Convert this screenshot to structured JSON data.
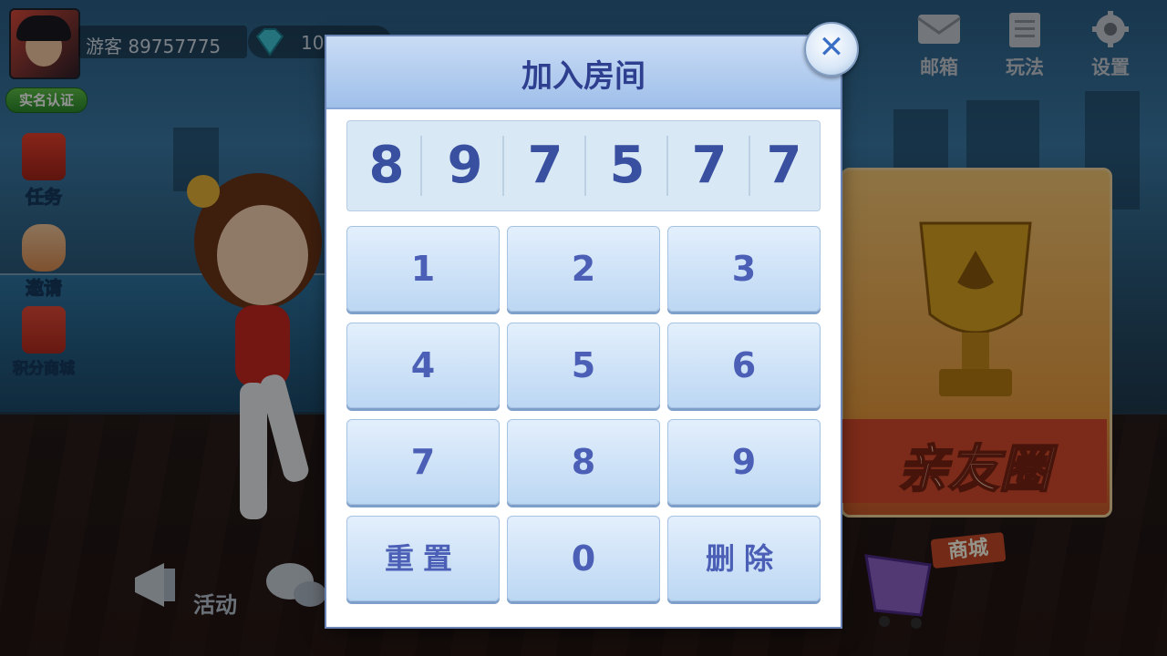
{
  "player": {
    "name": "游客 89757775",
    "gems_visible": "10",
    "verify_label": "实名认证"
  },
  "left_menu": [
    {
      "id": "tasks",
      "label": "任务",
      "icon": "task-icon"
    },
    {
      "id": "invite",
      "label": "邀请",
      "icon": "thumbs-up-icon"
    },
    {
      "id": "points-shop",
      "label": "积分商城",
      "icon": "gift-icon"
    }
  ],
  "top_menu": [
    {
      "id": "mailbox",
      "label": "邮箱",
      "icon": "mail-icon"
    },
    {
      "id": "rules",
      "label": "玩法",
      "icon": "rules-icon"
    },
    {
      "id": "settings",
      "label": "设置",
      "icon": "gear-icon"
    }
  ],
  "background": {
    "friends_circle_label": "亲友圈",
    "activity_label": "活动",
    "shop_label": "商城"
  },
  "modal": {
    "title": "加入房间",
    "close_symbol": "✕",
    "room_code": [
      "8",
      "9",
      "7",
      "5",
      "7",
      "7"
    ],
    "keys": {
      "k1": "1",
      "k2": "2",
      "k3": "3",
      "k4": "4",
      "k5": "5",
      "k6": "6",
      "k7": "7",
      "k8": "8",
      "k9": "9",
      "reset": "重置",
      "k0": "0",
      "delete": "删除"
    }
  },
  "colors": {
    "title": "#2f3f8f",
    "digit": "#3950a0",
    "key_text": "#4a5fb5",
    "header_bg": "#9fbfea"
  }
}
